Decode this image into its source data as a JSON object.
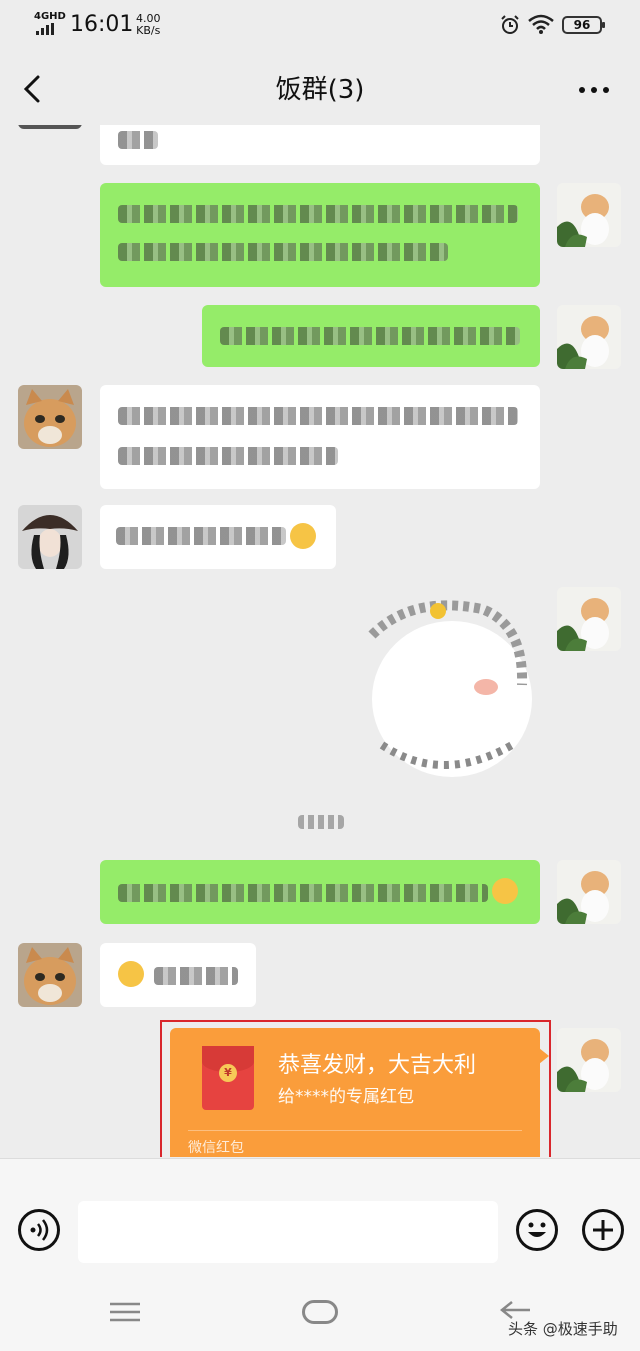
{
  "status_bar": {
    "network": "4GHD",
    "time": "16:01",
    "speed_value": "4.00",
    "speed_unit": "KB/s",
    "battery": "96"
  },
  "header": {
    "title": "饭群(3)",
    "back_icon": "chevron-left-icon",
    "more_icon": "more-dots-icon"
  },
  "red_packet": {
    "title": "恭喜发财，大吉大利",
    "subtitle": "给****的专属红包",
    "footer": "微信红包",
    "coin_symbol": "¥",
    "colors": {
      "card": "#fa9d3b",
      "envelope": "#e64340",
      "frame": "#d9262c"
    }
  },
  "input_bar": {
    "voice_icon": "voice-icon",
    "emoji_icon": "emoji-icon",
    "plus_icon": "plus-icon",
    "message_value": ""
  },
  "watermark": "头条 @极速手助",
  "colors": {
    "sent_bubble": "#95ec69",
    "received_bubble": "#ffffff",
    "background": "#ededed"
  }
}
